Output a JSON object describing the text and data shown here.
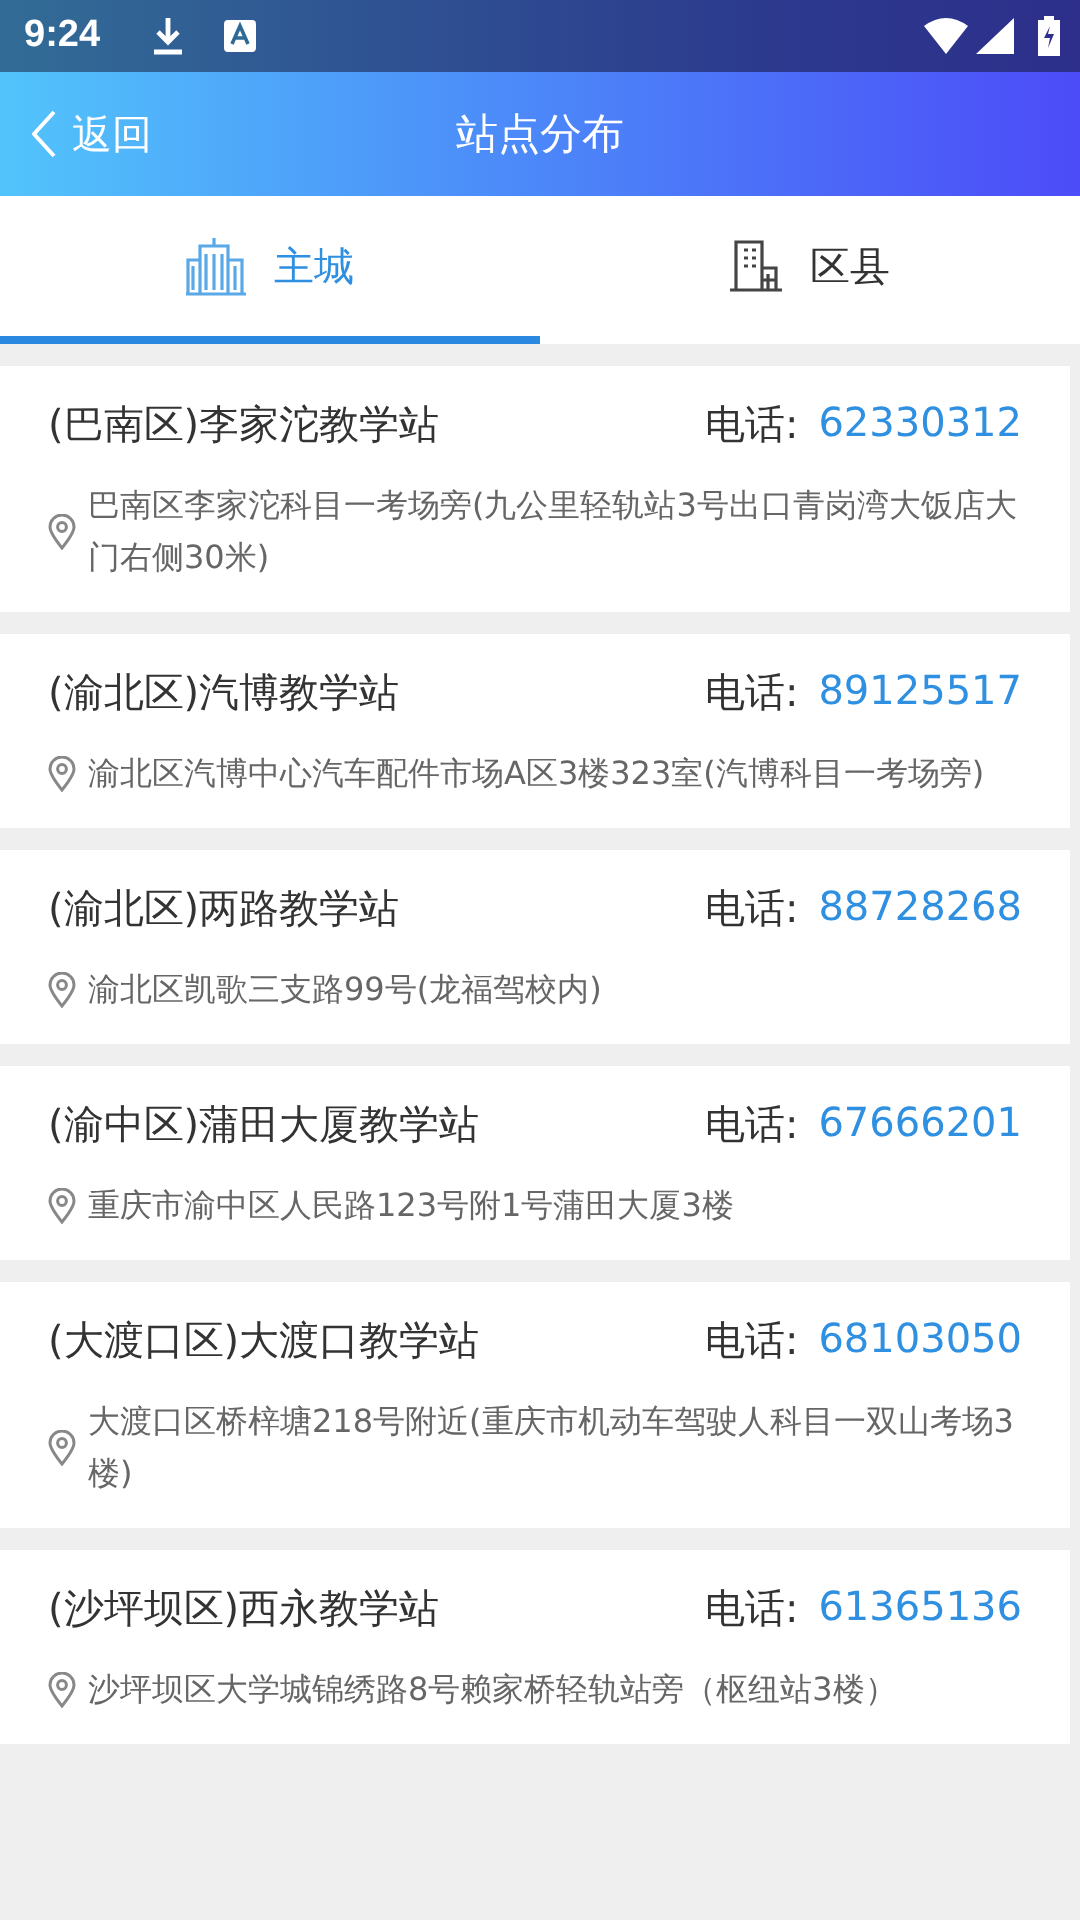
{
  "status_bar": {
    "time": "9:24"
  },
  "header": {
    "back": "返回",
    "title": "站点分布"
  },
  "tabs": [
    {
      "label": "主城",
      "kind": "city",
      "selected": true
    },
    {
      "label": "区县",
      "kind": "building",
      "selected": false
    }
  ],
  "stations": [
    {
      "name": "(巴南区)李家沱教学站",
      "phone_label": "电话:",
      "phone": "62330312",
      "address": "巴南区李家沱科目一考场旁(九公里轻轨站3号出口青岗湾大饭店大门右侧30米)"
    },
    {
      "name": "(渝北区)汽博教学站",
      "phone_label": "电话:",
      "phone": "89125517",
      "address": "渝北区汽博中心汽车配件市场A区3楼323室(汽博科目一考场旁)"
    },
    {
      "name": "(渝北区)两路教学站",
      "phone_label": "电话:",
      "phone": "88728268",
      "address": "渝北区凯歌三支路99号(龙福驾校内)"
    },
    {
      "name": "(渝中区)蒲田大厦教学站",
      "phone_label": "电话:",
      "phone": "67666201",
      "address": "重庆市渝中区人民路123号附1号蒲田大厦3楼"
    },
    {
      "name": "(大渡口区)大渡口教学站",
      "phone_label": "电话:",
      "phone": "68103050",
      "address": "大渡口区桥梓塘218号附近(重庆市机动车驾驶人科目一双山考场3楼)"
    },
    {
      "name": "(沙坪坝区)西永教学站",
      "phone_label": "电话:",
      "phone": "61365136",
      "address": "沙坪坝区大学城锦绣路8号赖家桥轻轨站旁（枢纽站3楼）"
    }
  ]
}
